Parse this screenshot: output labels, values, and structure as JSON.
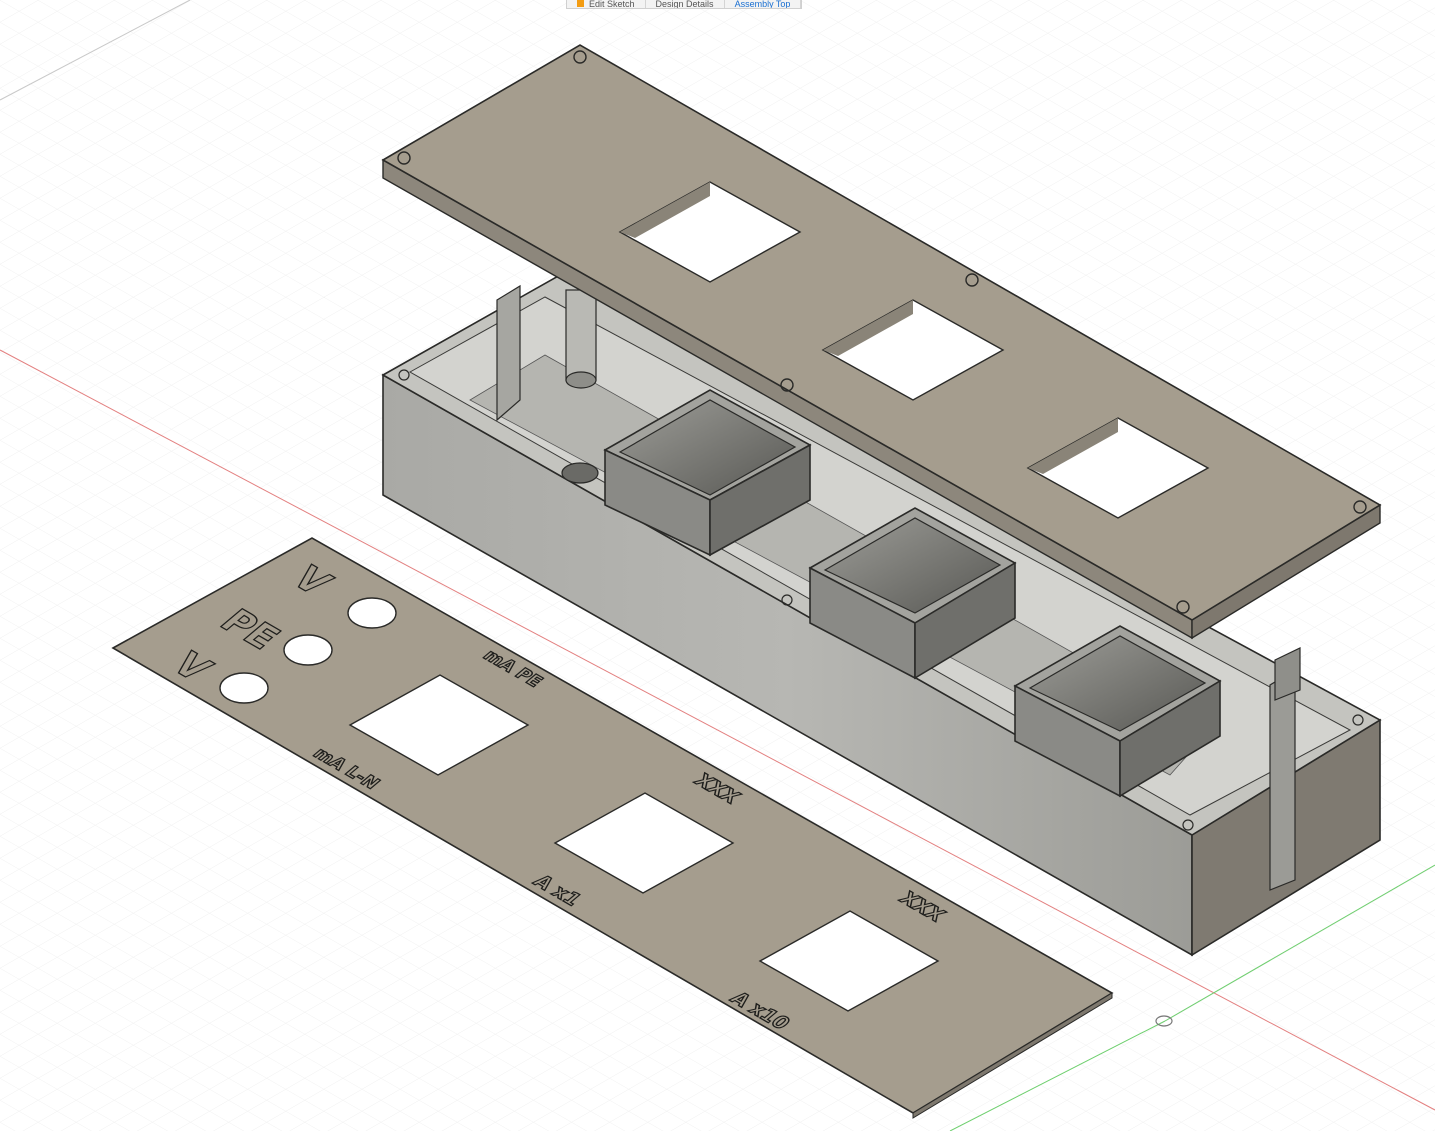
{
  "viewport_label": "Fusion 360 3D viewport",
  "toolbar_tabs": [
    {
      "label": "Edit Sketch",
      "link": false
    },
    {
      "label": "Design Details",
      "link": false
    },
    {
      "label": "Assembly Top",
      "link": true
    }
  ],
  "faceplate_labels": {
    "label_v_left": "V",
    "label_pe": "PE",
    "label_v_right": "V",
    "label_ma_pe": "mA PE",
    "label_ma_ln": "mA L-N",
    "label_xxx_1": "XXX",
    "label_a_x1": "A x1",
    "label_xxx_2": "XXX",
    "label_a_x10": "A x10"
  },
  "colors": {
    "grid_minor": "#e9e9e9",
    "grid_major": "#d6d6d6",
    "axis_x": "#e06060",
    "axis_y": "#56c256",
    "body_light": "#a8a092",
    "body_mid": "#948c7e",
    "body_dark": "#7c766b",
    "inner_wall": "#bcbcb7",
    "edge": "#2a2a28"
  }
}
